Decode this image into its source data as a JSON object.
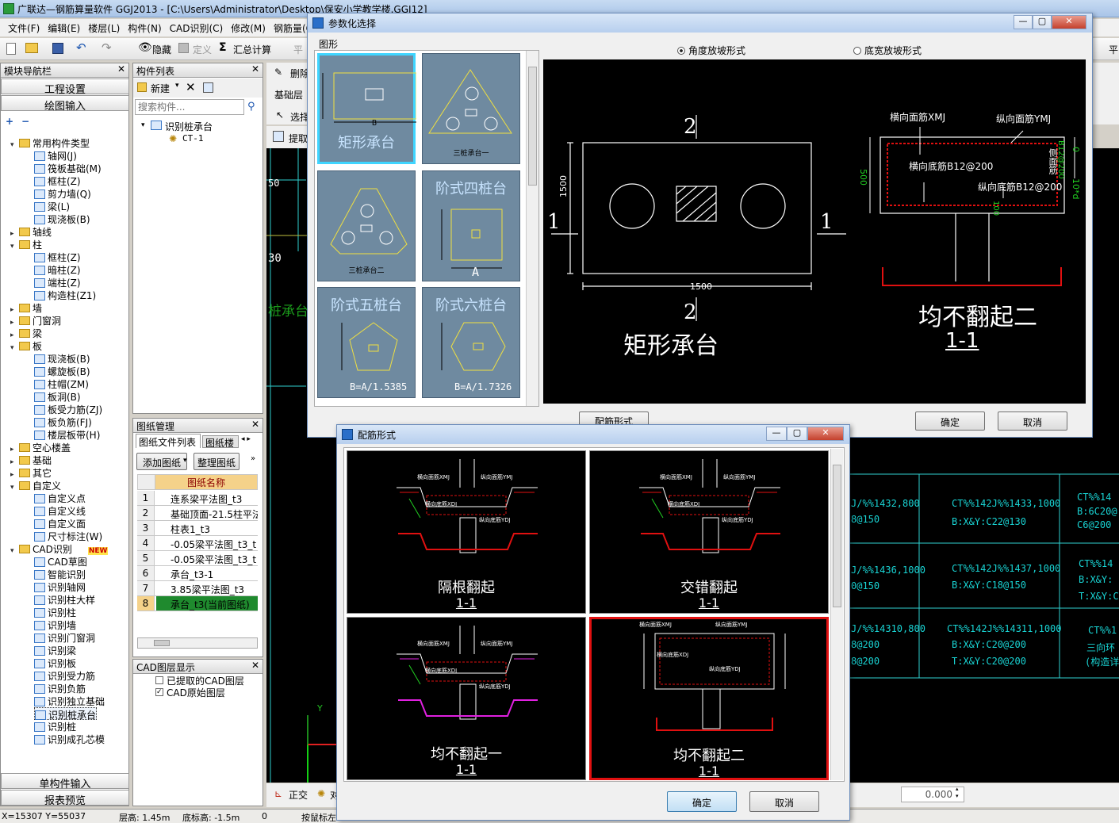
{
  "app": {
    "title": "广联达—钢筋算量软件 GGJ2013 - [C:\\Users\\Administrator\\Desktop\\保安小学教学楼.GGJ12]"
  },
  "menu": [
    "文件(F)",
    "编辑(E)",
    "楼层(L)",
    "构件(N)",
    "CAD识别(C)",
    "修改(M)",
    "钢筋量(Q"
  ],
  "toolbar": {
    "hide": "隐藏",
    "define": "定义",
    "sum_calc": "汇总计算",
    "flat": "平",
    "flat2": "平"
  },
  "nav": {
    "title": "模块导航栏",
    "project_settings": "工程设置",
    "drawing_input": "绘图输入",
    "single_input": "单构件输入",
    "report_preview": "报表预览",
    "tree": [
      {
        "label": "常用构件类型",
        "level": 1,
        "kind": "folder",
        "toggle": "▾"
      },
      {
        "label": "轴网(J)",
        "level": 2,
        "kind": "icon"
      },
      {
        "label": "筏板基础(M)",
        "level": 2,
        "kind": "icon"
      },
      {
        "label": "框柱(Z)",
        "level": 2,
        "kind": "icon"
      },
      {
        "label": "剪力墙(Q)",
        "level": 2,
        "kind": "icon"
      },
      {
        "label": "梁(L)",
        "level": 2,
        "kind": "icon"
      },
      {
        "label": "现浇板(B)",
        "level": 2,
        "kind": "icon"
      },
      {
        "label": "轴线",
        "level": 1,
        "kind": "folder",
        "toggle": "▸"
      },
      {
        "label": "柱",
        "level": 1,
        "kind": "folder",
        "toggle": "▾"
      },
      {
        "label": "框柱(Z)",
        "level": 2,
        "kind": "icon"
      },
      {
        "label": "暗柱(Z)",
        "level": 2,
        "kind": "icon"
      },
      {
        "label": "端柱(Z)",
        "level": 2,
        "kind": "icon"
      },
      {
        "label": "构造柱(Z1)",
        "level": 2,
        "kind": "icon"
      },
      {
        "label": "墙",
        "level": 1,
        "kind": "folder",
        "toggle": "▸"
      },
      {
        "label": "门窗洞",
        "level": 1,
        "kind": "folder",
        "toggle": "▸"
      },
      {
        "label": "梁",
        "level": 1,
        "kind": "folder",
        "toggle": "▸"
      },
      {
        "label": "板",
        "level": 1,
        "kind": "folder",
        "toggle": "▾"
      },
      {
        "label": "现浇板(B)",
        "level": 2,
        "kind": "icon"
      },
      {
        "label": "螺旋板(B)",
        "level": 2,
        "kind": "icon"
      },
      {
        "label": "柱帽(ZM)",
        "level": 2,
        "kind": "icon"
      },
      {
        "label": "板洞(B)",
        "level": 2,
        "kind": "icon"
      },
      {
        "label": "板受力筋(ZJ)",
        "level": 2,
        "kind": "icon"
      },
      {
        "label": "板负筋(FJ)",
        "level": 2,
        "kind": "icon"
      },
      {
        "label": "楼层板带(H)",
        "level": 2,
        "kind": "icon"
      },
      {
        "label": "空心楼盖",
        "level": 1,
        "kind": "folder",
        "toggle": "▸"
      },
      {
        "label": "基础",
        "level": 1,
        "kind": "folder",
        "toggle": "▸"
      },
      {
        "label": "其它",
        "level": 1,
        "kind": "folder",
        "toggle": "▸"
      },
      {
        "label": "自定义",
        "level": 1,
        "kind": "folder",
        "toggle": "▾"
      },
      {
        "label": "自定义点",
        "level": 2,
        "kind": "icon"
      },
      {
        "label": "自定义线",
        "level": 2,
        "kind": "icon"
      },
      {
        "label": "自定义面",
        "level": 2,
        "kind": "icon"
      },
      {
        "label": "尺寸标注(W)",
        "level": 2,
        "kind": "icon"
      },
      {
        "label": "CAD识别",
        "level": 1,
        "kind": "folder",
        "toggle": "▾",
        "badge": "NEW"
      },
      {
        "label": "CAD草图",
        "level": 2,
        "kind": "icon"
      },
      {
        "label": "智能识别",
        "level": 2,
        "kind": "icon"
      },
      {
        "label": "识别轴网",
        "level": 2,
        "kind": "icon"
      },
      {
        "label": "识别柱大样",
        "level": 2,
        "kind": "icon"
      },
      {
        "label": "识别柱",
        "level": 2,
        "kind": "icon"
      },
      {
        "label": "识别墙",
        "level": 2,
        "kind": "icon"
      },
      {
        "label": "识别门窗洞",
        "level": 2,
        "kind": "icon"
      },
      {
        "label": "识别梁",
        "level": 2,
        "kind": "icon"
      },
      {
        "label": "识别板",
        "level": 2,
        "kind": "icon"
      },
      {
        "label": "识别受力筋",
        "level": 2,
        "kind": "icon"
      },
      {
        "label": "识别负筋",
        "level": 2,
        "kind": "icon"
      },
      {
        "label": "识别独立基础",
        "level": 2,
        "kind": "icon"
      },
      {
        "label": "识别桩承台",
        "level": 2,
        "kind": "icon",
        "selected": true
      },
      {
        "label": "识别桩",
        "level": 2,
        "kind": "icon"
      },
      {
        "label": "识别成孔芯模",
        "level": 2,
        "kind": "icon"
      }
    ]
  },
  "complist": {
    "title": "构件列表",
    "new_label": "新建",
    "search_placeholder": "搜索构件...",
    "root": "识别桩承台",
    "child": "CT-1"
  },
  "drawmgr": {
    "title": "图纸管理",
    "tab1": "图纸文件列表",
    "tab2": "图纸楼",
    "add_btn": "添加图纸",
    "sort_btn": "整理图纸",
    "col_name": "图纸名称",
    "rows": [
      {
        "n": "1",
        "name": "连系梁平法图_t3"
      },
      {
        "n": "2",
        "name": "基础顶面-21.5柱平法"
      },
      {
        "n": "3",
        "name": "柱表1_t3"
      },
      {
        "n": "4",
        "name": "-0.05梁平法图_t3_t"
      },
      {
        "n": "5",
        "name": "-0.05梁平法图_t3_t"
      },
      {
        "n": "6",
        "name": "承台_t3-1"
      },
      {
        "n": "7",
        "name": "3.85梁平法图_t3"
      },
      {
        "n": "8",
        "name": "承台_t3(当前图纸)",
        "current": true
      }
    ]
  },
  "cadlayer": {
    "title": "CAD图层显示",
    "item1": "已提取的CAD图层",
    "item2": "CAD原始图层"
  },
  "midtools": {
    "delete": "删除",
    "base_layer": "基础层",
    "select": "选择",
    "extract": "提取",
    "ortho": "正交",
    "ortho2": "对"
  },
  "param_dialog": {
    "title": "参数化选择",
    "group": "图形",
    "radio1": "角度放坡形式",
    "radio2": "底宽放坡形式",
    "rebar_btn": "配筋形式",
    "ok": "确定",
    "cancel": "取消",
    "thumbs": [
      {
        "label": "矩形承台",
        "dim": "B",
        "selected": true
      },
      {
        "label": "三桩承台一",
        "dim": ""
      },
      {
        "label": "三桩承台二",
        "dim": ""
      },
      {
        "label": "阶式四桩台",
        "dim": "A"
      },
      {
        "label": "阶式五桩台",
        "dim": "B=A/1.5385"
      },
      {
        "label": "阶式六桩台",
        "dim": "B=A/1.7326"
      }
    ],
    "preview": {
      "sec_top": "2",
      "sec_bot": "2",
      "sec_left": "1",
      "sec_right": "1",
      "dim_v": "1500",
      "dim_h": "1500",
      "shape_name": "矩形承台",
      "xmj": "横向面筋XMJ",
      "ymj": "纵向面筋YMJ",
      "xdj": "横向底筋B12@200",
      "ydj": "纵向底筋B12@200",
      "side": "侧面筋",
      "side_val": "B12@200",
      "h500": "500",
      "d0": "0",
      "d10": "10*d",
      "d100": "100",
      "sec_name": "均不翻起二",
      "sec_sub": "1-1"
    }
  },
  "rebar_dialog": {
    "title": "配筋形式",
    "ok": "确定",
    "cancel": "取消",
    "options": [
      {
        "label": "隔根翻起",
        "sub": "1-1"
      },
      {
        "label": "交错翻起",
        "sub": "1-1"
      },
      {
        "label": "均不翻起一",
        "sub": "1-1"
      },
      {
        "label": "均不翻起二",
        "sub": "1-1",
        "selected": true
      }
    ],
    "lbl_xmj": "横向面筋XMJ",
    "lbl_ymj": "纵向面筋YMJ",
    "lbl_xdj": "横向底筋XDJ",
    "lbl_ydj": "纵向底筋YDJ"
  },
  "cadbg": {
    "c1": "J/%%1432,800",
    "c1b": "8@150",
    "c2": "CT%%142J%%1433,1000",
    "c2b": "B:X&Y:C22@130",
    "c3": "CT%%14",
    "c3b": "B:6C20@",
    "c3c": "C6@200",
    "c4": "J/%%1436,1000",
    "c4b": "0@150",
    "c5": "CT%%142J%%1437,1000",
    "c5b": "B:X&Y:C18@150",
    "c6": "CT%%14",
    "c6b": "B:X&Y:",
    "c6c": "T:X&Y:C",
    "c7": "J/%%14310,800",
    "c7b": "8@200",
    "c7c": "8@200",
    "c8": "CT%%142J%%14311,1000",
    "c8b": "B:X&Y:C20@200",
    "c8c": "T:X&Y:C20@200",
    "c9": "CT%%1",
    "c9b": "三向环",
    "c9c": "(构造详",
    "left1": "50",
    "left2": "30",
    "left3": "桩承台",
    "spin": "0.000"
  },
  "status": {
    "coord": "X=15307 Y=55037",
    "floor_h": "层高: 1.45m",
    "bot_h": "底标高: -1.5m",
    "val": "0",
    "hint": "按鼠标左"
  }
}
